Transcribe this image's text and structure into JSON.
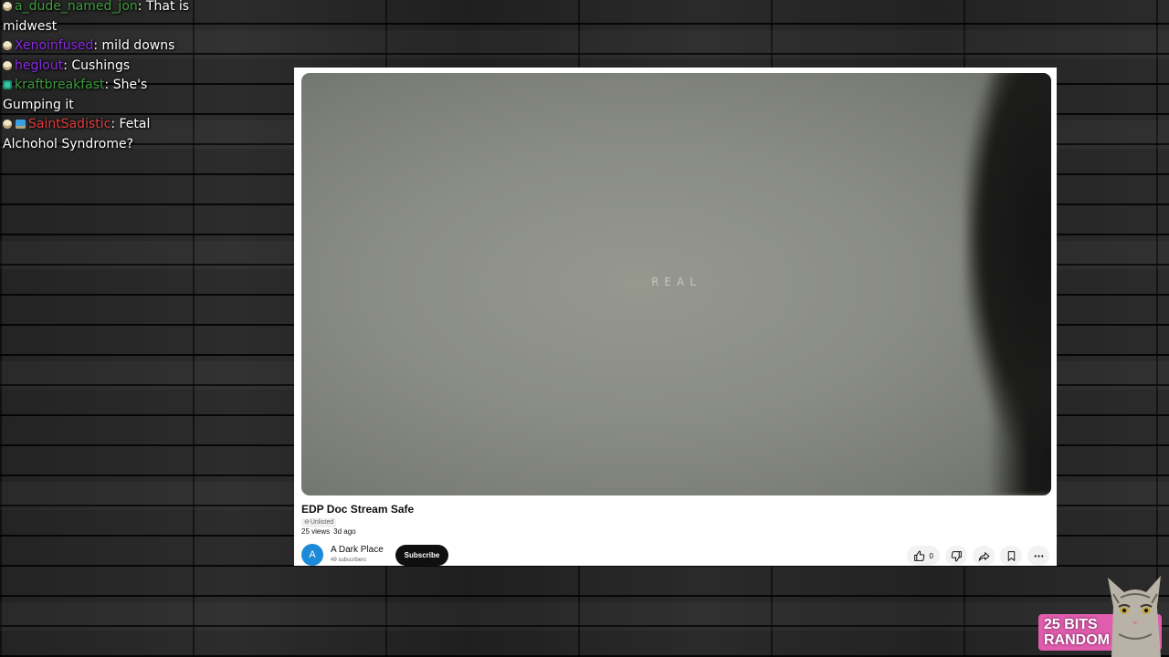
{
  "chat": [
    {
      "badges": [
        "round"
      ],
      "user": "a_dude_named_jon",
      "user_color": "#3e9a3e",
      "message": "That is midwest"
    },
    {
      "badges": [
        "round"
      ],
      "user": "Xenoinfused",
      "user_color": "#8a2be2",
      "message": "mild downs"
    },
    {
      "badges": [
        "round"
      ],
      "user": "heglout",
      "user_color": "#8a2be2",
      "message": "Cushings"
    },
    {
      "badges": [
        "square"
      ],
      "user": "kraftbreakfast",
      "user_color": "#3e9a3e",
      "message": "She's Gumping it"
    },
    {
      "badges": [
        "round",
        "sub"
      ],
      "user": "SaintSadistic",
      "user_color": "#e03a3a",
      "message": "Fetal Alchohol Syndrome?"
    }
  ],
  "video": {
    "caption": "REAL",
    "title": "EDP Doc Stream Safe",
    "visibility": "Unlisted",
    "views": "25 views",
    "age": "3d ago",
    "channel": {
      "avatar_letter": "A",
      "name": "A Dark Place",
      "subscribers": "49 subscribers"
    },
    "subscribe_label": "Subscribe",
    "likes": "0",
    "action_icons": [
      "thumbs-up-icon",
      "thumbs-down-icon",
      "share-icon",
      "save-icon",
      "more-icon"
    ]
  },
  "alert": {
    "line1": "25 BITS",
    "line2": "RANDOM SORB",
    "color": "#e05dae"
  }
}
